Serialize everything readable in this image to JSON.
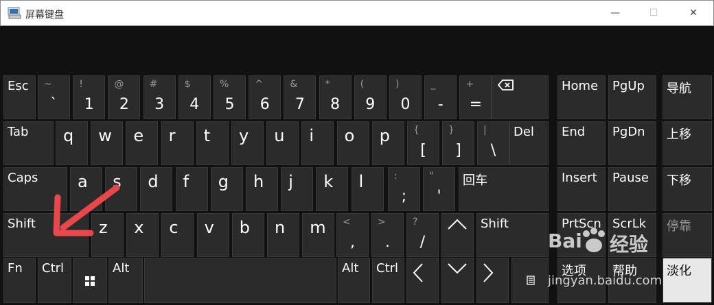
{
  "window": {
    "title": "屏幕键盘",
    "minimize_glyph": "—",
    "maximize_glyph": "☐",
    "close_glyph": "✕"
  },
  "colors": {
    "key_bg": "#2b2b2b",
    "highlight_bg": "#e8e8e8",
    "annotation_arrow": "#e8474b"
  },
  "row1": {
    "esc": "Esc",
    "keys": [
      {
        "sym": "~",
        "main": "`"
      },
      {
        "sym": "!",
        "main": "1"
      },
      {
        "sym": "@",
        "main": "2"
      },
      {
        "sym": "#",
        "main": "3"
      },
      {
        "sym": "$",
        "main": "4"
      },
      {
        "sym": "%",
        "main": "5"
      },
      {
        "sym": "^",
        "main": "6"
      },
      {
        "sym": "&",
        "main": "7"
      },
      {
        "sym": "*",
        "main": "8"
      },
      {
        "sym": "(",
        "main": "9"
      },
      {
        "sym": ")",
        "main": "0"
      },
      {
        "sym": "_",
        "main": "-"
      },
      {
        "sym": "+",
        "main": "="
      }
    ],
    "backspace_icon": "backspace-icon",
    "home": "Home",
    "pgup": "PgUp",
    "nav": "导航"
  },
  "row2": {
    "tab": "Tab",
    "letters": [
      "q",
      "w",
      "e",
      "r",
      "t",
      "y",
      "u",
      "i",
      "o",
      "p"
    ],
    "brackets": [
      {
        "sym": "{",
        "main": "["
      },
      {
        "sym": "}",
        "main": "]"
      },
      {
        "sym": "|",
        "main": "\\"
      }
    ],
    "del": "Del",
    "end": "End",
    "pgdn": "PgDn",
    "move_up": "上移"
  },
  "row3": {
    "caps": "Caps",
    "letters": [
      "a",
      "s",
      "d",
      "f",
      "g",
      "h",
      "j",
      "k",
      "l"
    ],
    "punct": [
      {
        "sym": ":",
        "main": ";"
      },
      {
        "sym": "\"",
        "main": "'"
      }
    ],
    "enter": "回车",
    "insert": "Insert",
    "pause": "Pause",
    "move_down": "下移"
  },
  "row4": {
    "shift_left": "Shift",
    "letters": [
      "z",
      "x",
      "c",
      "v",
      "b",
      "n",
      "m"
    ],
    "punct": [
      {
        "sym": "<",
        "main": ","
      },
      {
        "sym": ">",
        "main": "."
      },
      {
        "sym": "?",
        "main": "/"
      }
    ],
    "up_icon": "chevron-up-icon",
    "shift_right": "Shift",
    "prtscn": "PrtScn",
    "scrlk": "ScrLk",
    "dock": "停靠"
  },
  "row5": {
    "fn": "Fn",
    "ctrl_left": "Ctrl",
    "win_icon": "windows-icon",
    "alt_left": "Alt",
    "alt_right": "Alt",
    "ctrl_right": "Ctrl",
    "left_icon": "chevron-left-icon",
    "down_icon": "chevron-down-icon",
    "right_icon": "chevron-right-icon",
    "menu_icon": "menu-icon",
    "options": "选项",
    "help": "帮助",
    "fade": "淡化"
  },
  "watermark": {
    "brand": "Bai",
    "brand_cn": "经验",
    "url": "jingyan.baidu.com"
  }
}
